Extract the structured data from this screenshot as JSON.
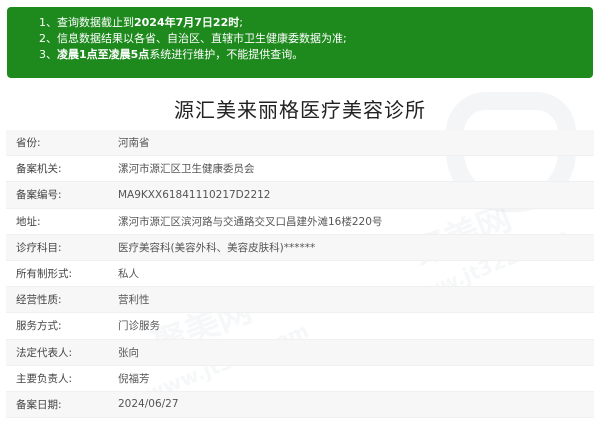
{
  "notice": {
    "line1": {
      "prefix": "1、查询数据截止到",
      "bold": "2024年7月7日22时",
      "suffix": ";"
    },
    "line2": {
      "text": "2、信息数据结果以各省、自治区、直辖市卫生健康委数据为准;"
    },
    "line3": {
      "prefix": "3、",
      "bold1": "凌晨1点至凌晨5点",
      "suffix": "系统进行维护，不能提供查询。"
    }
  },
  "title": "源汇美来丽格医疗美容诊所",
  "watermark": {
    "text1": "聚美网",
    "text2": "www.jt322.com"
  },
  "rows": [
    {
      "label": "省份:",
      "value": "河南省"
    },
    {
      "label": "备案机关:",
      "value": "漯河市源汇区卫生健康委员会"
    },
    {
      "label": "备案编号:",
      "value": "MA9KXX61841110217D2212"
    },
    {
      "label": "地址:",
      "value": "漯河市源汇区滨河路与交通路交叉口昌建外滩16楼220号"
    },
    {
      "label": "诊疗科目:",
      "value": "医疗美容科(美容外科、美容皮肤科)******"
    },
    {
      "label": "所有制形式:",
      "value": "私人"
    },
    {
      "label": "经营性质:",
      "value": "营利性"
    },
    {
      "label": "服务方式:",
      "value": "门诊服务"
    },
    {
      "label": "法定代表人:",
      "value": "张向"
    },
    {
      "label": "主要负责人:",
      "value": "倪福芳"
    },
    {
      "label": "备案日期:",
      "value": "2024/06/27"
    }
  ]
}
